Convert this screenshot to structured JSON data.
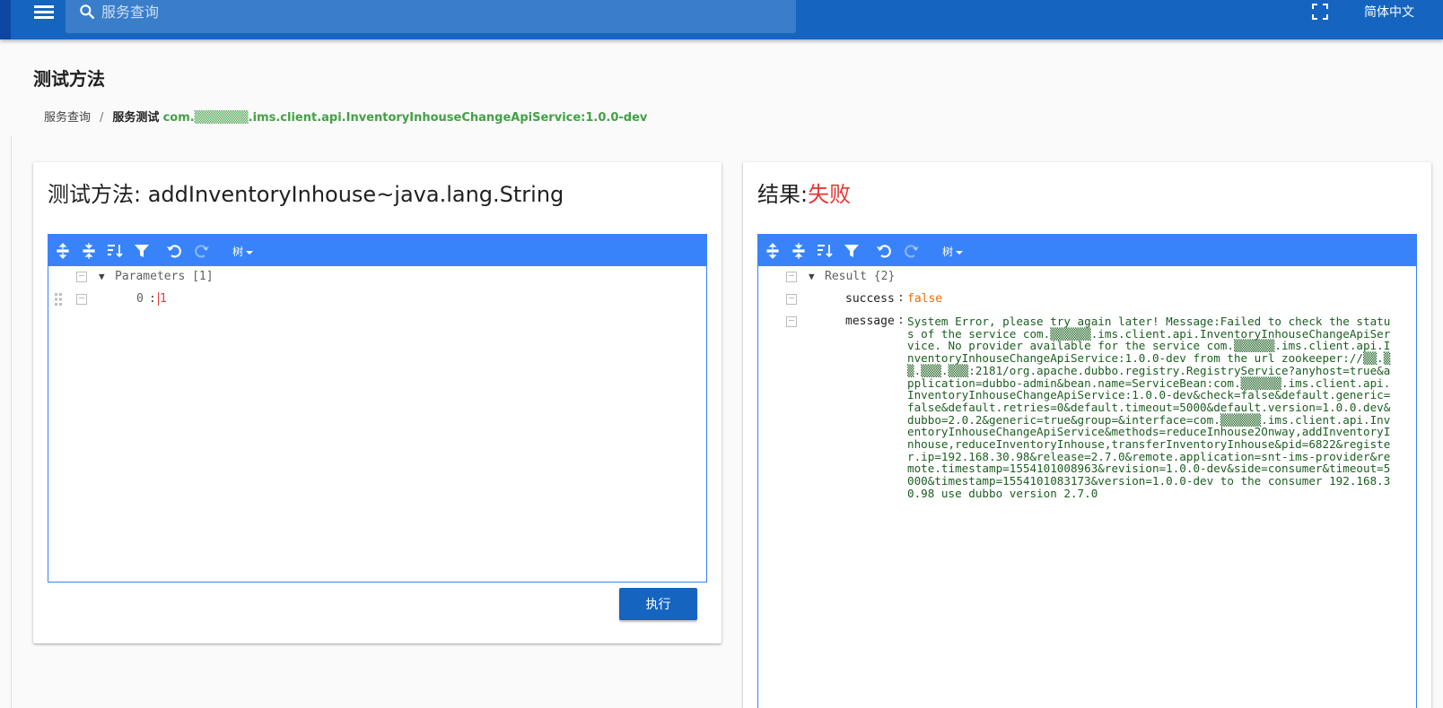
{
  "topbar": {
    "search_placeholder": "服务查询",
    "language": "简体中文"
  },
  "page": {
    "title": "测试方法"
  },
  "breadcrumb": {
    "home": "服务查询",
    "separator": "/",
    "current_label": "服务测试",
    "service_name": "com.▒▒▒▒▒▒.ims.client.api.InventoryInhouseChangeApiService:1.0.0-dev"
  },
  "left_panel": {
    "title_prefix": "测试方法: ",
    "method": "addInventoryInhouse~java.lang.String",
    "editor": {
      "mode_label": "树",
      "root_label": "Parameters [1]",
      "params": [
        {
          "key": "0",
          "value": "1"
        }
      ]
    },
    "execute_label": "执行"
  },
  "right_panel": {
    "title_prefix": "结果:",
    "status": "失败",
    "editor": {
      "mode_label": "树",
      "root_label": "Result {2}",
      "fields": [
        {
          "key": "success",
          "value": "false"
        },
        {
          "key": "message",
          "value": "System Error, please try again later! Message:Failed to check the status of the service com.▒▒▒▒▒▒.ims.client.api.InventoryInhouseChangeApiService. No provider available for the service com.▒▒▒▒▒▒.ims.client.api.InventoryInhouseChangeApiService:1.0.0-dev from the url zookeeper://▒▒.▒▒.▒▒▒.▒▒▒:2181/org.apache.dubbo.registry.RegistryService?anyhost=true&application=dubbo-admin&bean.name=ServiceBean:com.▒▒▒▒▒▒.ims.client.api.InventoryInhouseChangeApiService:1.0.0-dev&check=false&default.generic=false&default.retries=0&default.timeout=5000&default.version=1.0.0.dev&dubbo=2.0.2&generic=true&group=&interface=com.▒▒▒▒▒▒.ims.client.api.InventoryInhouseChangeApiService&methods=reduceInhouse2Onway,addInventoryInhouse,reduceInventoryInhouse,transferInventoryInhouse&pid=6822&register.ip=192.168.30.98&release=2.7.0&remote.application=snt-ims-provider&remote.timestamp=1554101008963&revision=1.0.0-dev&side=consumer&timeout=5000&timestamp=1554101083173&version=1.0.0-dev to the consumer 192.168.30.98 use dubbo version 2.7.0"
        }
      ]
    }
  },
  "colors": {
    "primary": "#1565c0",
    "editor_blue": "#3883fa",
    "fail_red": "#e53935",
    "service_green": "#43a047",
    "string_green": "#1b5e20",
    "bool_orange": "#ef6c00"
  }
}
